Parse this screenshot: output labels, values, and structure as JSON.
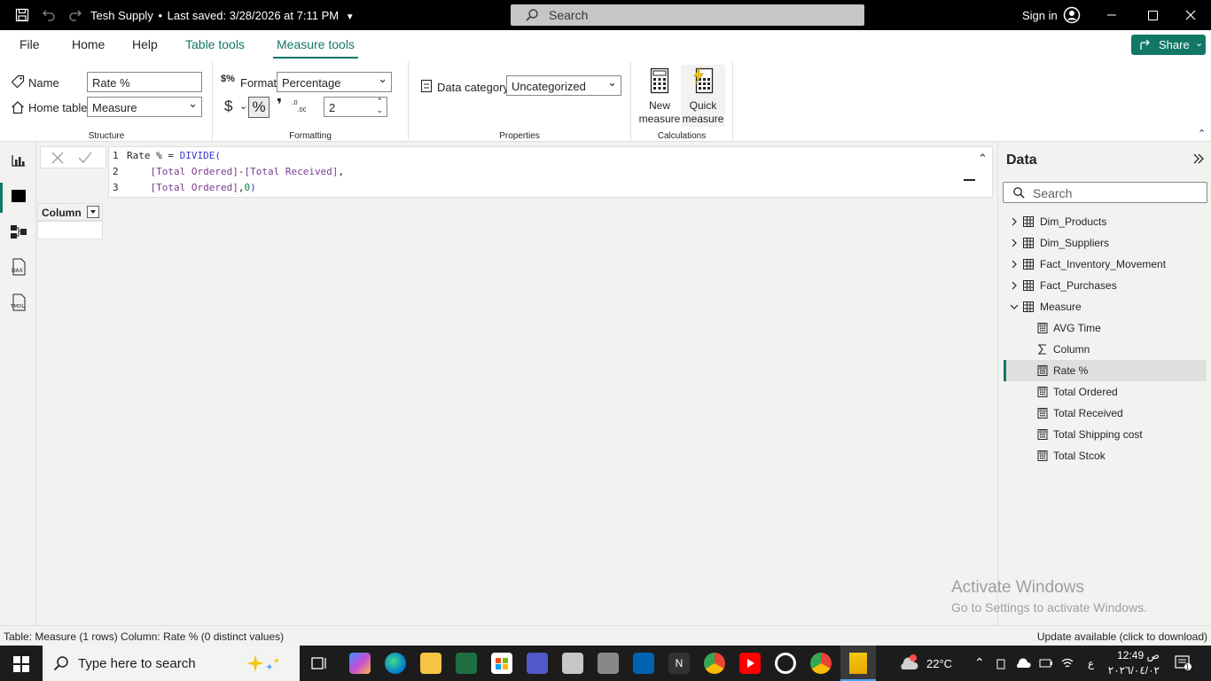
{
  "titlebar": {
    "file_name": "Tesh Supply",
    "saved_status": "Last saved: 3/28/2026 at 7:11 PM",
    "search_placeholder": "Search",
    "signin_label": "Sign in"
  },
  "tabs": {
    "file": "File",
    "home": "Home",
    "help": "Help",
    "table_tools": "Table tools",
    "measure_tools": "Measure tools"
  },
  "share_label": "Share",
  "ribbon": {
    "name_label": "Name",
    "name_value": "Rate %",
    "home_table_label": "Home table",
    "home_table_value": "Measure",
    "structure_group": "Structure",
    "format_label": "Format",
    "format_value": "Percentage",
    "currency_symbol": "$",
    "percent_symbol": "%",
    "comma_symbol": "❜",
    "decimal_places": "2",
    "formatting_group": "Formatting",
    "data_category_label": "Data category",
    "data_category_value": "Uncategorized",
    "properties_group": "Properties",
    "new_measure_label_1": "New",
    "new_measure_label_2": "measure",
    "quick_measure_label_1": "Quick",
    "quick_measure_label_2": "measure",
    "calculations_group": "Calculations"
  },
  "formula": {
    "line_numbers": [
      "1",
      "2",
      "3"
    ],
    "line1_name": "Rate % = ",
    "line1_func": "DIVIDE(",
    "line2_indent": "    ",
    "line2_col1": "[Total Ordered]",
    "line2_op": "-",
    "line2_col2": "[Total Received]",
    "line2_end": ",",
    "line3_indent": "    ",
    "line3_col": "[Total Ordered]",
    "line3_sep": ",",
    "line3_num": "0",
    "line3_end": ")"
  },
  "table": {
    "column_header": "Column"
  },
  "data_pane": {
    "title": "Data",
    "search_placeholder": "Search",
    "tables": [
      "Dim_Products",
      "Dim_Suppliers",
      "Fact_Inventory_Movement",
      "Fact_Purchases"
    ],
    "measure_table": "Measure",
    "measures": [
      "AVG Time",
      "Column",
      "Rate %",
      "Total Ordered",
      "Total Received",
      "Total Shipping cost",
      "Total Stcok"
    ],
    "selected_measure": "Rate %"
  },
  "status_bar": {
    "left": "Table: Measure (1 rows) Column: Rate % (0 distinct values)",
    "right": "Update available (click to download)"
  },
  "watermark": {
    "line1": "Activate Windows",
    "line2": "Go to Settings to activate Windows."
  },
  "taskbar": {
    "search_placeholder": "Type here to search",
    "temperature": "22°C",
    "time": "12:49 ص",
    "date": "٢٠٢٦/٠٤/٠٢",
    "lang": "ع",
    "notification_count": "1"
  },
  "colors": {
    "accent": "#117865",
    "titlebar": "#000000",
    "taskbar": "#1c1c1c"
  }
}
